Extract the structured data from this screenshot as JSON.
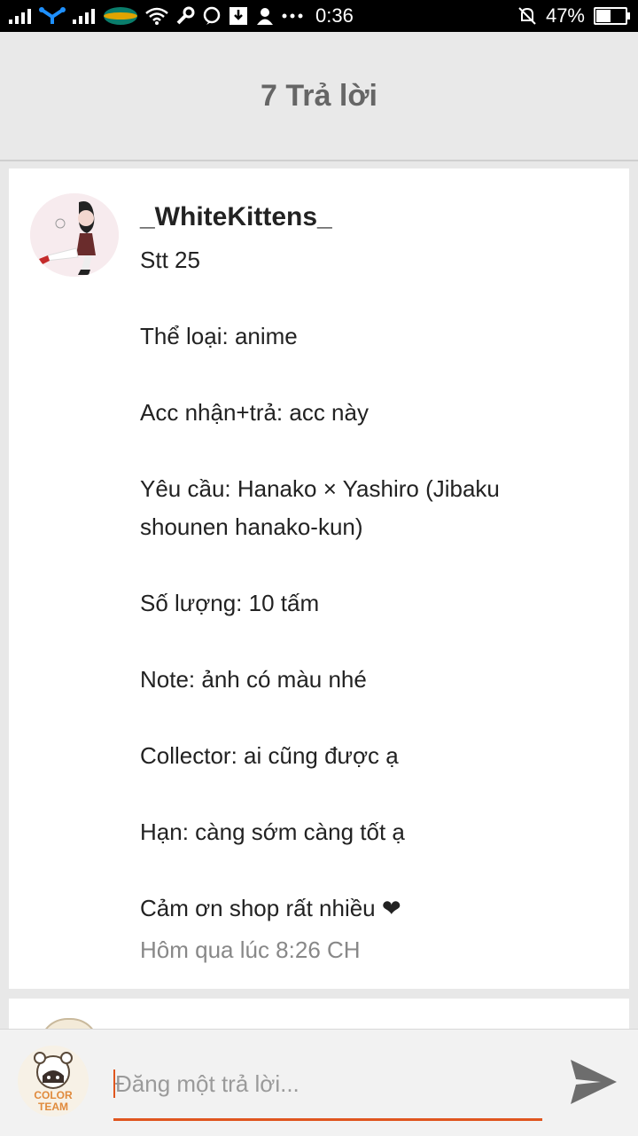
{
  "status_bar": {
    "time": "0:36",
    "battery": "47%",
    "battery_level": 0.47,
    "left_icons": [
      "signal-icon",
      "network-icon",
      "signal-icon",
      "carrier-logo",
      "wifi-icon",
      "wrench-icon",
      "viber-icon",
      "download-icon",
      "person-icon",
      "more-icon"
    ],
    "right_icons": [
      "silent-bell-icon",
      "battery-icon"
    ]
  },
  "header": {
    "title": "7 Trả lời"
  },
  "post": {
    "username": "_WhiteKittens_",
    "lines": [
      "Stt 25",
      "Thể loại: anime",
      "Acc nhận+trả: acc này",
      "Yêu cầu: Hanako × Yashiro (Jibaku shounen hanako-kun)",
      "Số lượng: 10 tấm",
      "Note: ảnh có màu nhé",
      "Collector: ai cũng được ạ",
      "Hạn: càng sớm càng tốt ạ",
      "Cảm ơn shop rất nhiều ❤"
    ],
    "timestamp": "Hôm qua lúc 8:26 CH"
  },
  "reply": {
    "placeholder": "Đăng một trả lời...",
    "avatar_text": [
      "COLOR",
      "TEAM"
    ],
    "accent_color": "#e0561f"
  }
}
